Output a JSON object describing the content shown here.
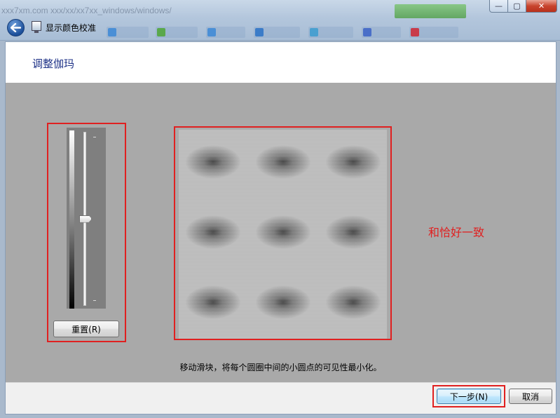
{
  "window": {
    "title": "显示颜色校准",
    "background_url": "xxx7xm.com  xxx/xx/xx7xx_windows/windows/",
    "minimize_glyph": "—",
    "maximize_glyph": "▢",
    "close_glyph": "✕"
  },
  "page": {
    "heading": "调整伽玛",
    "instruction": "移动滑块，将每个圆圈中间的小圆点的可见性最小化。",
    "annotation": "和恰好一致"
  },
  "slider": {
    "value_fraction": 0.5,
    "reset_label": "重置(R)"
  },
  "buttons": {
    "next_label": "下一步(N)",
    "cancel_label": "取消"
  },
  "colors": {
    "highlight": "#e02020",
    "heading": "#1e3287",
    "gray_area": "#a9a9a9"
  }
}
